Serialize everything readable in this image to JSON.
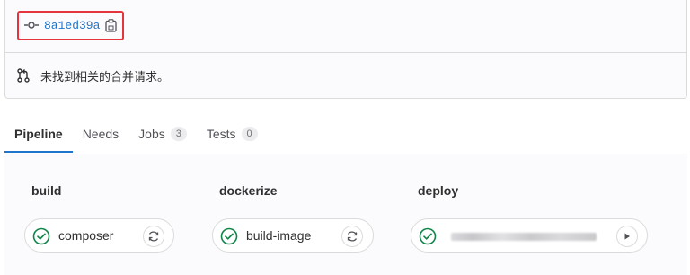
{
  "commit": {
    "sha": "8a1ed39a"
  },
  "merge_request": {
    "message": "未找到相关的合并请求。"
  },
  "tabs": [
    {
      "label": "Pipeline",
      "active": true
    },
    {
      "label": "Needs"
    },
    {
      "label": "Jobs",
      "count": "3"
    },
    {
      "label": "Tests",
      "count": "0"
    }
  ],
  "stages": [
    {
      "title": "build",
      "job": {
        "name": "composer",
        "status": "success",
        "action": "retry-icon"
      }
    },
    {
      "title": "dockerize",
      "job": {
        "name": "build-image",
        "status": "success",
        "action": "retry-icon"
      }
    },
    {
      "title": "deploy",
      "job": {
        "name": "",
        "status": "success",
        "action": "play-icon",
        "name_redacted": true
      }
    }
  ],
  "colors": {
    "success": "#108548",
    "link": "#1f75cb",
    "highlight": "#e5343e",
    "tab_underline": "#1f75cb"
  }
}
